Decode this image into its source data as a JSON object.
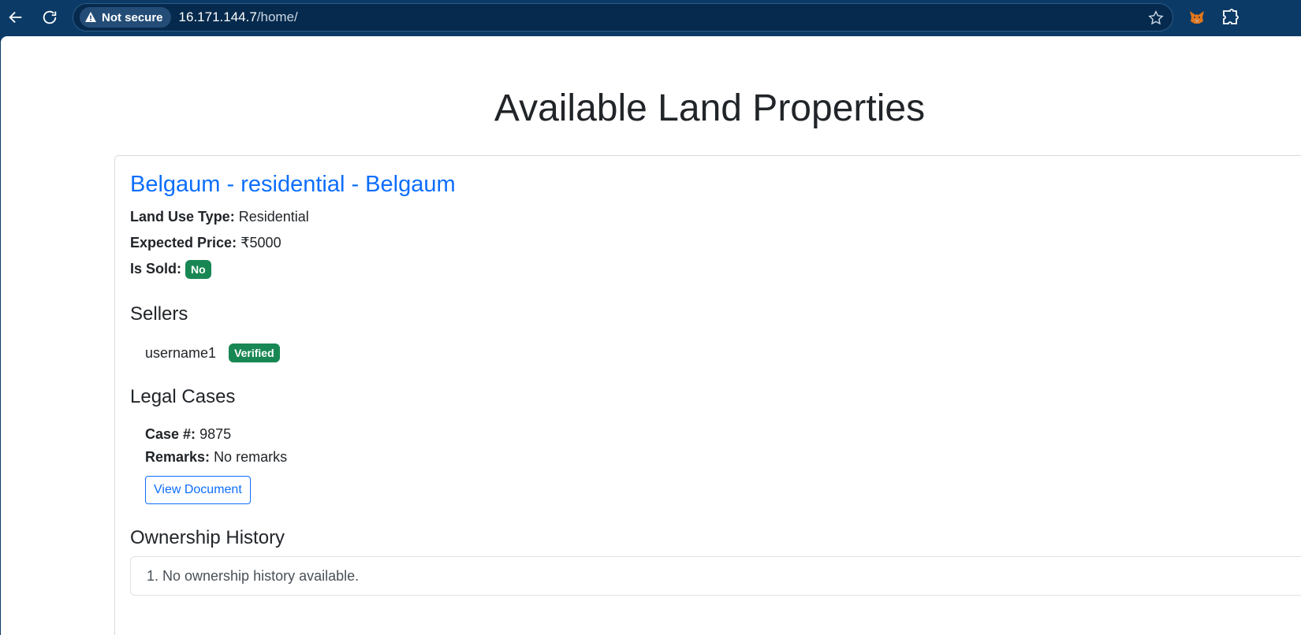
{
  "browser": {
    "security_label": "Not secure",
    "url_host": "16.171.144.7",
    "url_path": "/home/"
  },
  "page": {
    "title": "Available Land Properties"
  },
  "property": {
    "title": "Belgaum - residential - Belgaum",
    "land_use_label": "Land Use Type:",
    "land_use_value": "Residential",
    "price_label": "Expected Price:",
    "price_value": "₹5000",
    "sold_label": "Is Sold:",
    "sold_badge": "No",
    "sellers_heading": "Sellers",
    "sellers": [
      {
        "name": "username1",
        "status": "Verified"
      }
    ],
    "legal_heading": "Legal Cases",
    "case_label": "Case #:",
    "case_value": "9875",
    "remarks_label": "Remarks:",
    "remarks_value": "No remarks",
    "view_document_label": "View Document",
    "history_heading": "Ownership History",
    "history_items": [
      "1. No ownership history available."
    ]
  },
  "colors": {
    "chrome_bg": "#0b3a66",
    "link_blue": "#0d6efd",
    "badge_green": "#198754"
  }
}
